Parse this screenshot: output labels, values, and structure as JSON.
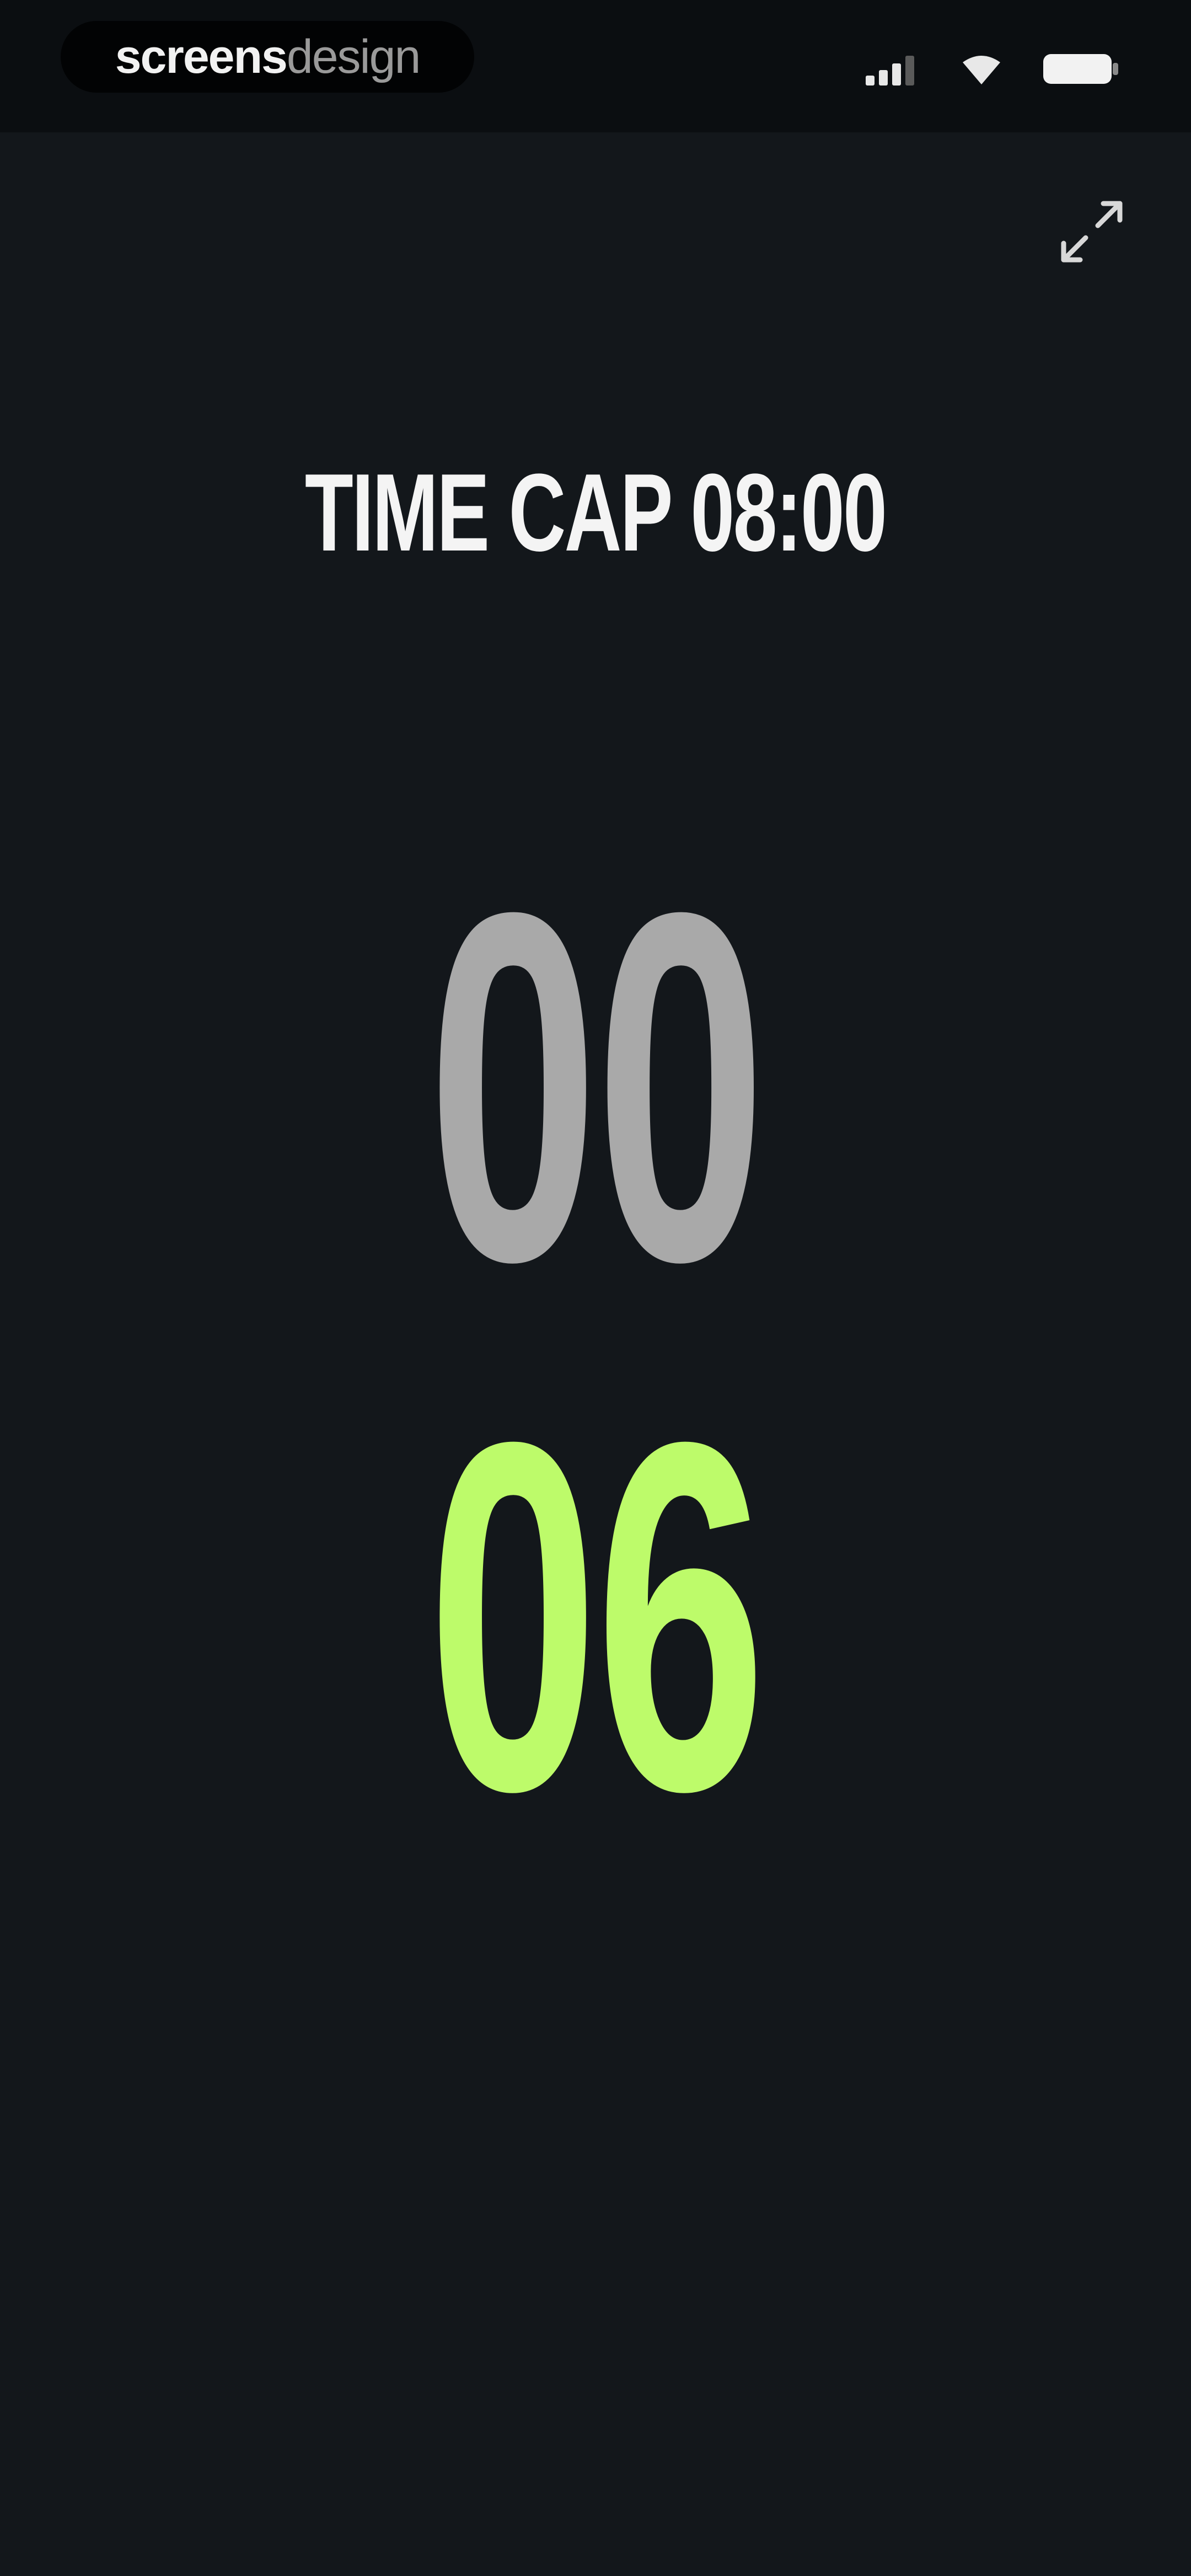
{
  "status_bar": {
    "brand_part1": "screens",
    "brand_part2": "design",
    "icons": [
      "cellular-signal-icon",
      "wifi-icon",
      "battery-icon"
    ]
  },
  "header": {
    "fullscreen_icon": "expand-arrows-icon"
  },
  "timer": {
    "time_cap": "TIME CAP 08:00",
    "minutes": "00",
    "seconds": "06"
  },
  "colors": {
    "background": "#13171b",
    "status_bar_bg": "#0b0e11",
    "minutes_color": "#a9a9a9",
    "seconds_color": "#bdfb6a",
    "label_color": "#f4f4f4"
  }
}
